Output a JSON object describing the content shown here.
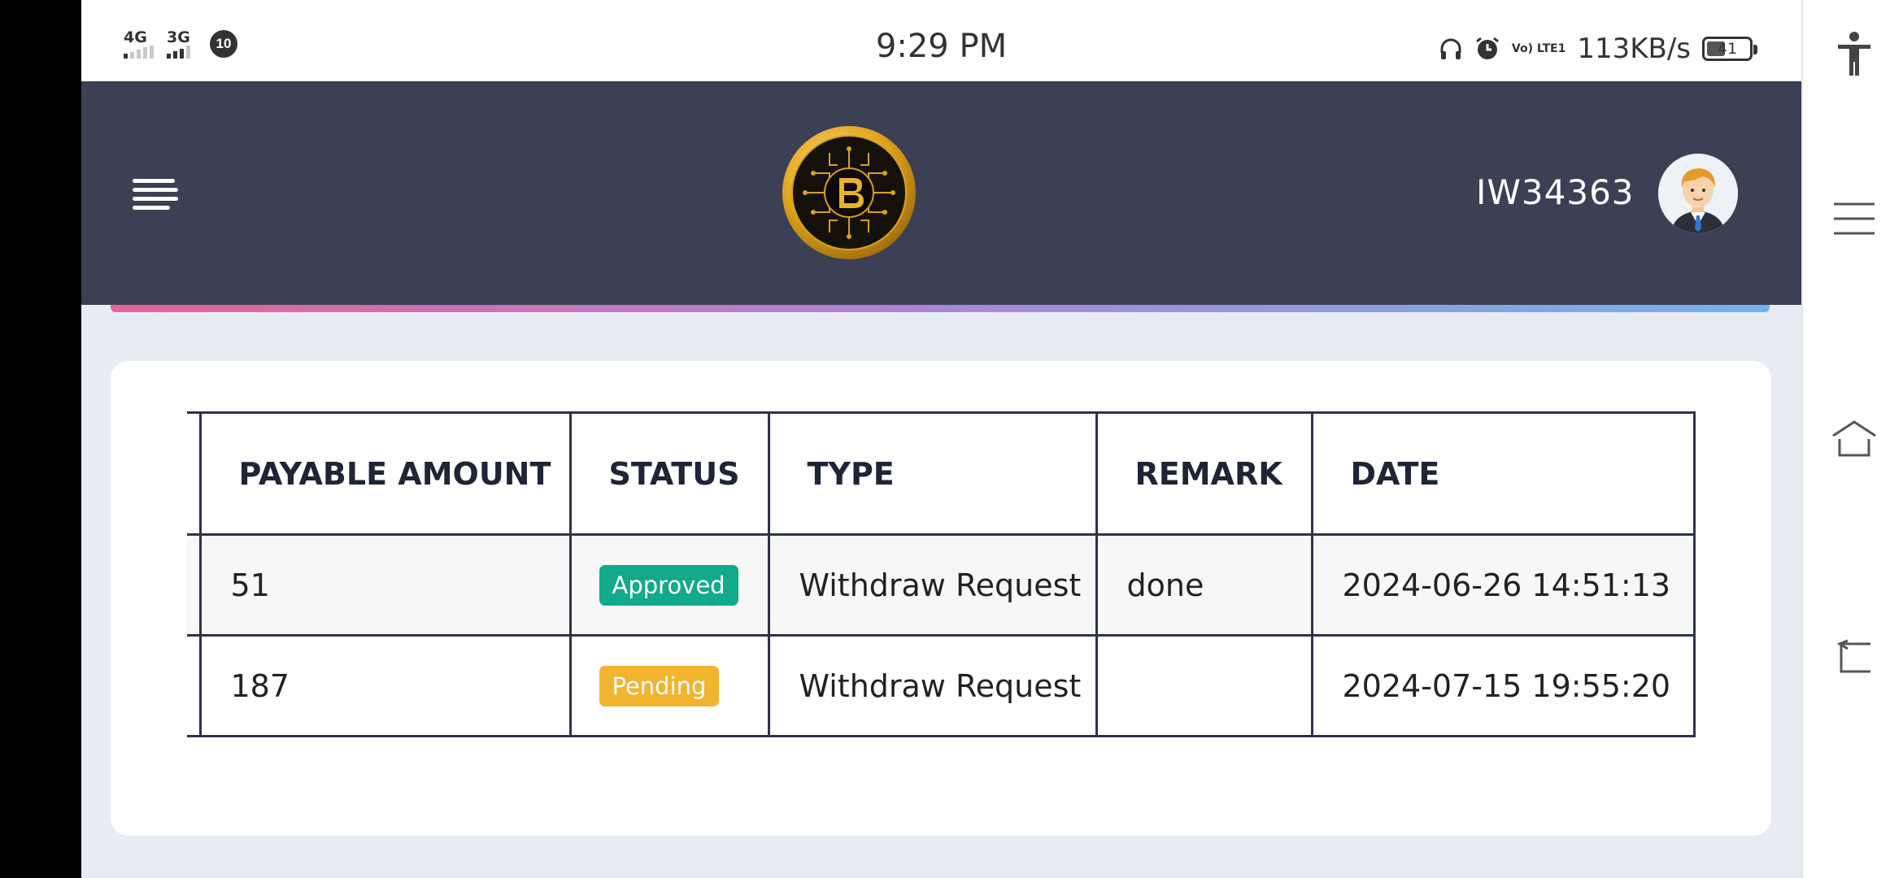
{
  "status_bar": {
    "time": "9:29 PM",
    "sim1": "4G",
    "sim2": "3G",
    "notification_count": "10",
    "volte": "Vo) LTE1",
    "net_speed": "113KB/s",
    "battery": "41"
  },
  "header": {
    "user_id": "IW34363"
  },
  "table": {
    "columns": [
      "PAYABLE AMOUNT",
      "STATUS",
      "TYPE",
      "REMARK",
      "DATE"
    ],
    "rows": [
      {
        "amount": "51",
        "status": "Approved",
        "type": "Withdraw Request",
        "remark": "done",
        "date": "2024-06-26 14:51:13"
      },
      {
        "amount": "187",
        "status": "Pending",
        "type": "Withdraw Request",
        "remark": "",
        "date": "2024-07-15 19:55:20"
      }
    ]
  },
  "colors": {
    "header_bg": "#3b4054",
    "approved": "#13a98b",
    "pending": "#f2b42e",
    "page_bg": "#e8ebf3"
  },
  "icons": {
    "menu": "hamburger-menu-icon",
    "logo": "bitcoin-coin-logo",
    "avatar": "user-avatar",
    "nav": [
      "accessibility-icon",
      "menu-lines-icon",
      "home-icon",
      "back-icon"
    ]
  }
}
